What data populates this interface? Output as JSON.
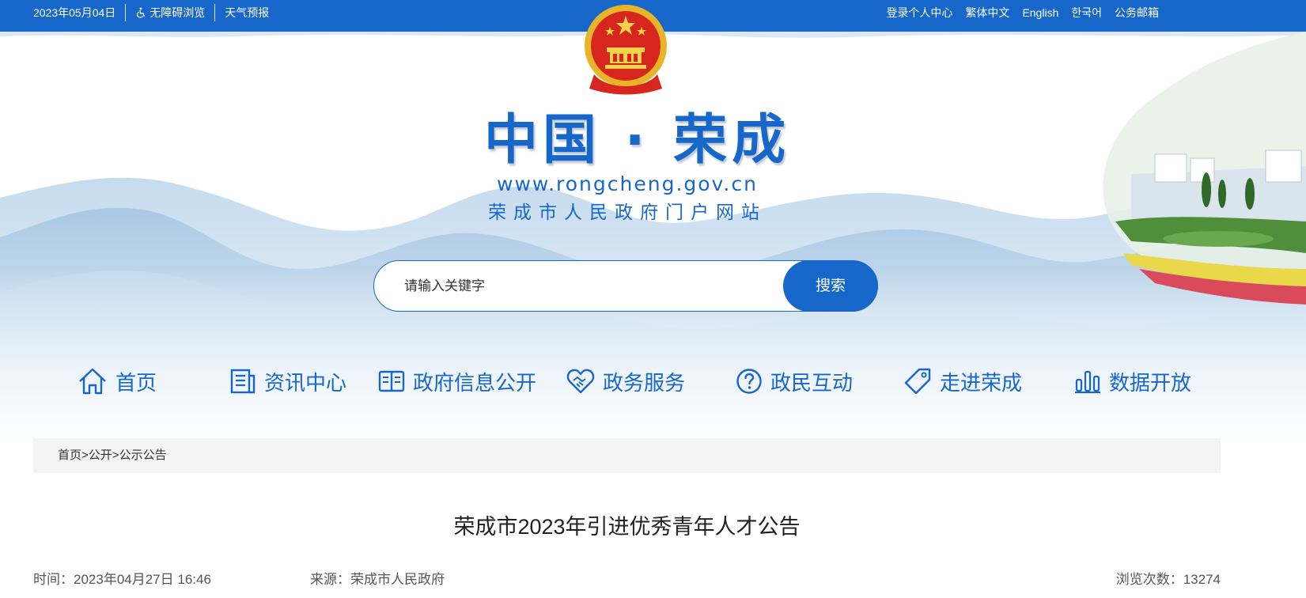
{
  "topbar": {
    "date": "2023年05月04日",
    "accessibility": "无障碍浏览",
    "weather": "天气预报",
    "links": [
      "登录个人中心",
      "繁体中文",
      "English",
      "한국어",
      "公务邮箱"
    ]
  },
  "header": {
    "title": "中国 · 荣成",
    "url": "www.rongcheng.gov.cn",
    "subtitle": "荣成市人民政府门户网站"
  },
  "search": {
    "placeholder": "请输入关键字",
    "button": "搜索"
  },
  "nav": [
    {
      "label": "首页",
      "icon": "home-icon"
    },
    {
      "label": "资讯中心",
      "icon": "news-icon"
    },
    {
      "label": "政府信息公开",
      "icon": "book-icon"
    },
    {
      "label": "政务服务",
      "icon": "handshake-heart-icon"
    },
    {
      "label": "政民互动",
      "icon": "question-icon"
    },
    {
      "label": "走进荣成",
      "icon": "tag-icon"
    },
    {
      "label": "数据开放",
      "icon": "bar-chart-icon"
    }
  ],
  "breadcrumb": [
    "首页",
    "公开",
    "公示公告"
  ],
  "breadcrumb_sep": ">",
  "article": {
    "title": "荣成市2023年引进优秀青年人才公告",
    "time": "时间：2023年04月27日 16:46",
    "source": "来源：荣成市人民政府",
    "views": "浏览次数：13274"
  },
  "colors": {
    "primary": "#1767cb",
    "breadcrumb_bg": "#f3f3f3"
  }
}
